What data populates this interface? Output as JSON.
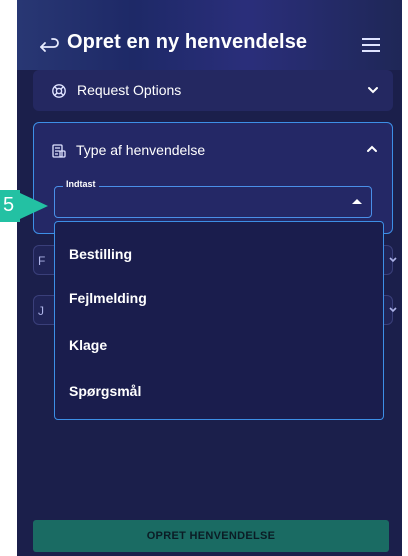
{
  "header": {
    "title": "Opret en ny henvendelse",
    "back_icon": "back-arrow-icon",
    "menu_icon": "hamburger-menu-icon"
  },
  "panels": [
    {
      "label": "Request Options",
      "icon": "lifebuoy-icon",
      "state": "collapsed"
    },
    {
      "label": "Type af henvendelse",
      "icon": "document-icon",
      "state": "expanded"
    }
  ],
  "type_field": {
    "legend": "Indtast",
    "value": ""
  },
  "dropdown": {
    "options": [
      "Bestilling",
      "Fejlmelding",
      "Klage",
      "Spørgsmål"
    ]
  },
  "hidden_rows": [
    {
      "label": "F"
    },
    {
      "label": "J"
    }
  ],
  "submit": {
    "label": "OPRET HENVENDELSE"
  },
  "annotation": {
    "badge": "5"
  },
  "colors": {
    "background": "#1b1f4b",
    "panel": "#242861",
    "accent_border": "#3d8fe6",
    "submit": "#1a6b63",
    "badge": "#23c1a3"
  }
}
